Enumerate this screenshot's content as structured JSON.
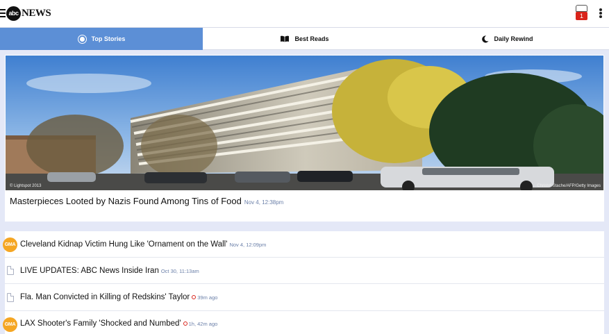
{
  "header": {
    "logo_mark": "abc",
    "logo_text": "NEWS",
    "notification_count": "1"
  },
  "tabs": [
    {
      "label": "Top Stories",
      "icon": "circle-dot-icon",
      "active": true
    },
    {
      "label": "Best Reads",
      "icon": "book-icon",
      "active": false
    },
    {
      "label": "Daily Rewind",
      "icon": "moon-icon",
      "active": false
    }
  ],
  "hero": {
    "title": "Masterpieces Looted by Nazis Found Among Tins of Food",
    "time": "Nov 4, 12:38pm",
    "credit_left": "© Lightspot 2013",
    "credit_right": "Christof Stache/AFP/Getty Images"
  },
  "stories": [
    {
      "title": "Cleveland Kidnap Victim Hung Like 'Ornament on the Wall'",
      "time": "Nov 4, 12:09pm",
      "icon": "gma-icon",
      "icon_label": "GMA",
      "recent": false
    },
    {
      "title": "LIVE UPDATES: ABC News Inside Iran",
      "time": "Oct 30, 11:13am",
      "icon": "document-icon",
      "recent": false
    },
    {
      "title": "Fla. Man Convicted in Killing of Redskins' Taylor",
      "time": "39m ago",
      "icon": "document-icon",
      "recent": true
    },
    {
      "title": "LAX Shooter's Family 'Shocked and Numbed'",
      "time": "1h, 42m ago",
      "icon": "gma-icon",
      "icon_label": "GMA",
      "recent": true
    }
  ],
  "colors": {
    "accent": "#5c8fd6",
    "badge": "#d9241b",
    "gma": "#f5a623"
  }
}
